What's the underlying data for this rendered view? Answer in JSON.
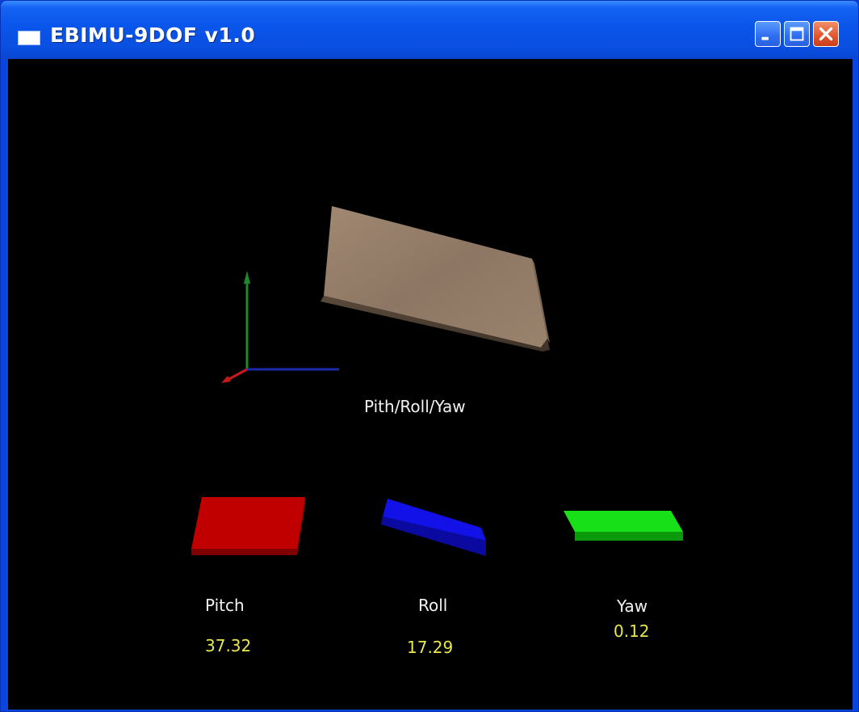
{
  "window": {
    "title": "EBIMU-9DOF v1.0",
    "buttons": [
      "minimize",
      "maximize",
      "close"
    ]
  },
  "scene": {
    "caption": "Pith/Roll/Yaw",
    "model_color": "#9b8570",
    "axes_colors": {
      "x": "#1a2aa8",
      "y": "#1c8a2a",
      "z": "#c41a1a"
    }
  },
  "indicators": [
    {
      "label": "Pitch",
      "value": "37.32",
      "color": "#c00000"
    },
    {
      "label": "Roll",
      "value": "17.29",
      "color": "#1010e0"
    },
    {
      "label": "Yaw",
      "value": "0.12",
      "color": "#18e018"
    }
  ],
  "colors": {
    "titlebar": "#0a55ea",
    "value_text": "#e8e84a",
    "label_text": "#f2f2f2"
  }
}
